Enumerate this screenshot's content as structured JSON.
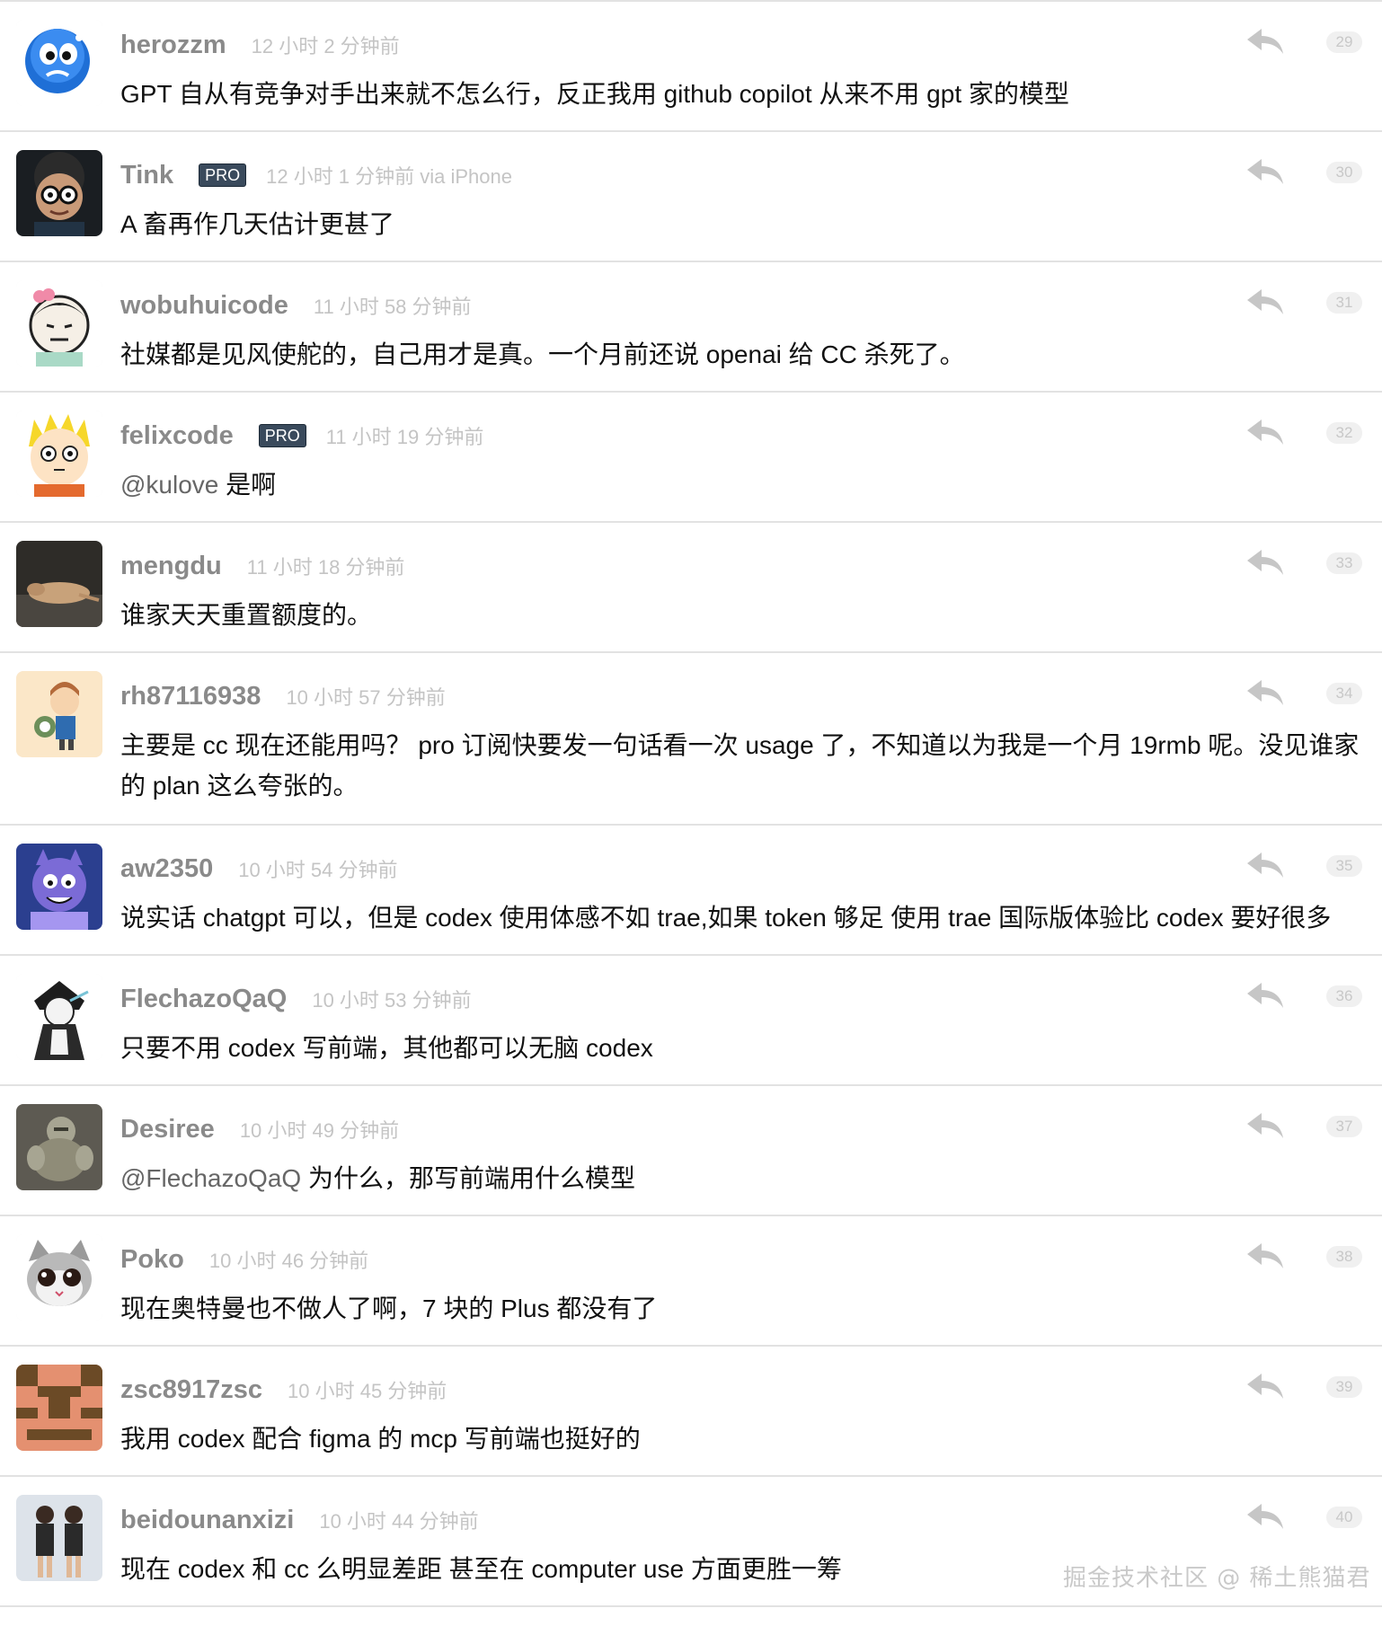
{
  "replies": [
    {
      "user": "herozzm",
      "pro": false,
      "time": "12 小时 2 分钟前",
      "text": "GPT 自从有竞争对手出来就不怎么行，反正我用 github copilot 从来不用 gpt 家的模型",
      "floor": "29"
    },
    {
      "user": "Tink",
      "pro": true,
      "time": "12 小时 1 分钟前 via iPhone",
      "text": "A 畜再作几天估计更甚了",
      "floor": "30"
    },
    {
      "user": "wobuhuicode",
      "pro": false,
      "time": "11 小时 58 分钟前",
      "text": "社媒都是见风使舵的，自己用才是真。一个月前还说 openai 给 CC 杀死了。",
      "floor": "31"
    },
    {
      "user": "felixcode",
      "pro": true,
      "time": "11 小时 19 分钟前",
      "mention": "@kulove",
      "text": " 是啊",
      "floor": "32"
    },
    {
      "user": "mengdu",
      "pro": false,
      "time": "11 小时 18 分钟前",
      "text": "谁家天天重置额度的。",
      "floor": "33"
    },
    {
      "user": "rh87116938",
      "pro": false,
      "time": "10 小时 57 分钟前",
      "text": "主要是 cc 现在还能用吗？ pro 订阅快要发一句话看一次 usage 了，不知道以为我是一个月 19rmb 呢。没见谁家的 plan 这么夸张的。",
      "floor": "34"
    },
    {
      "user": "aw2350",
      "pro": false,
      "time": "10 小时 54 分钟前",
      "text": "说实话 chatgpt 可以，但是 codex 使用体感不如 trae,如果 token 够足 使用 trae 国际版体验比 codex 要好很多",
      "floor": "35"
    },
    {
      "user": "FlechazoQaQ",
      "pro": false,
      "time": "10 小时 53 分钟前",
      "text": "只要不用 codex 写前端，其他都可以无脑 codex",
      "floor": "36"
    },
    {
      "user": "Desiree",
      "pro": false,
      "time": "10 小时 49 分钟前",
      "mention": "@FlechazoQaQ",
      "text": " 为什么，那写前端用什么模型",
      "floor": "37"
    },
    {
      "user": "Poko",
      "pro": false,
      "time": "10 小时 46 分钟前",
      "text": "现在奥特曼也不做人了啊，7 块的 Plus 都没有了",
      "floor": "38"
    },
    {
      "user": "zsc8917zsc",
      "pro": false,
      "time": "10 小时 45 分钟前",
      "text": "我用 codex 配合 figma 的 mcp 写前端也挺好的",
      "floor": "39"
    },
    {
      "user": "beidounanxizi",
      "pro": false,
      "time": "10 小时 44 分钟前",
      "text": "现在 codex 和 cc 么明显差距 甚至在 computer use 方面更胜一筹",
      "floor": "40"
    }
  ],
  "pro_label": "PRO",
  "watermark": "掘金技术社区 @ 稀土熊猫君"
}
